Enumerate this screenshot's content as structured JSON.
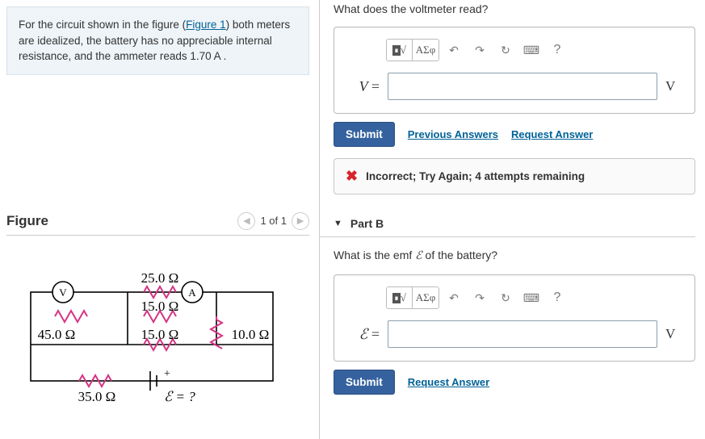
{
  "problem": {
    "pre": "For the circuit shown in the figure (",
    "link": "Figure 1",
    "post": ") both meters are idealized, the battery has no appreciable internal resistance, and the ammeter reads 1.70 A ."
  },
  "figure": {
    "title": "Figure",
    "pager": "1 of 1",
    "labels": {
      "r25": "25.0 Ω",
      "r15a": "15.0 Ω",
      "r15b": "15.0 Ω",
      "r10": "10.0 Ω",
      "r45": "45.0 Ω",
      "r35": "35.0 Ω",
      "emf": "ℰ = ?",
      "plus": "+",
      "volt": "V",
      "amp": "A"
    }
  },
  "partA": {
    "question": "What does the voltmeter read?",
    "toolbar": {
      "math": "x√",
      "greek": "ΑΣφ",
      "help": "?"
    },
    "var": "V",
    "unit": "V",
    "submit": "Submit",
    "prev": "Previous Answers",
    "request": "Request Answer",
    "feedback": "Incorrect; Try Again; 4 attempts remaining"
  },
  "partB": {
    "heading": "Part B",
    "question": "What is the emf ℰ of the battery?",
    "toolbar": {
      "math": "x√",
      "greek": "ΑΣφ",
      "help": "?"
    },
    "var": "ℰ",
    "unit": "V",
    "submit": "Submit",
    "request": "Request Answer"
  }
}
